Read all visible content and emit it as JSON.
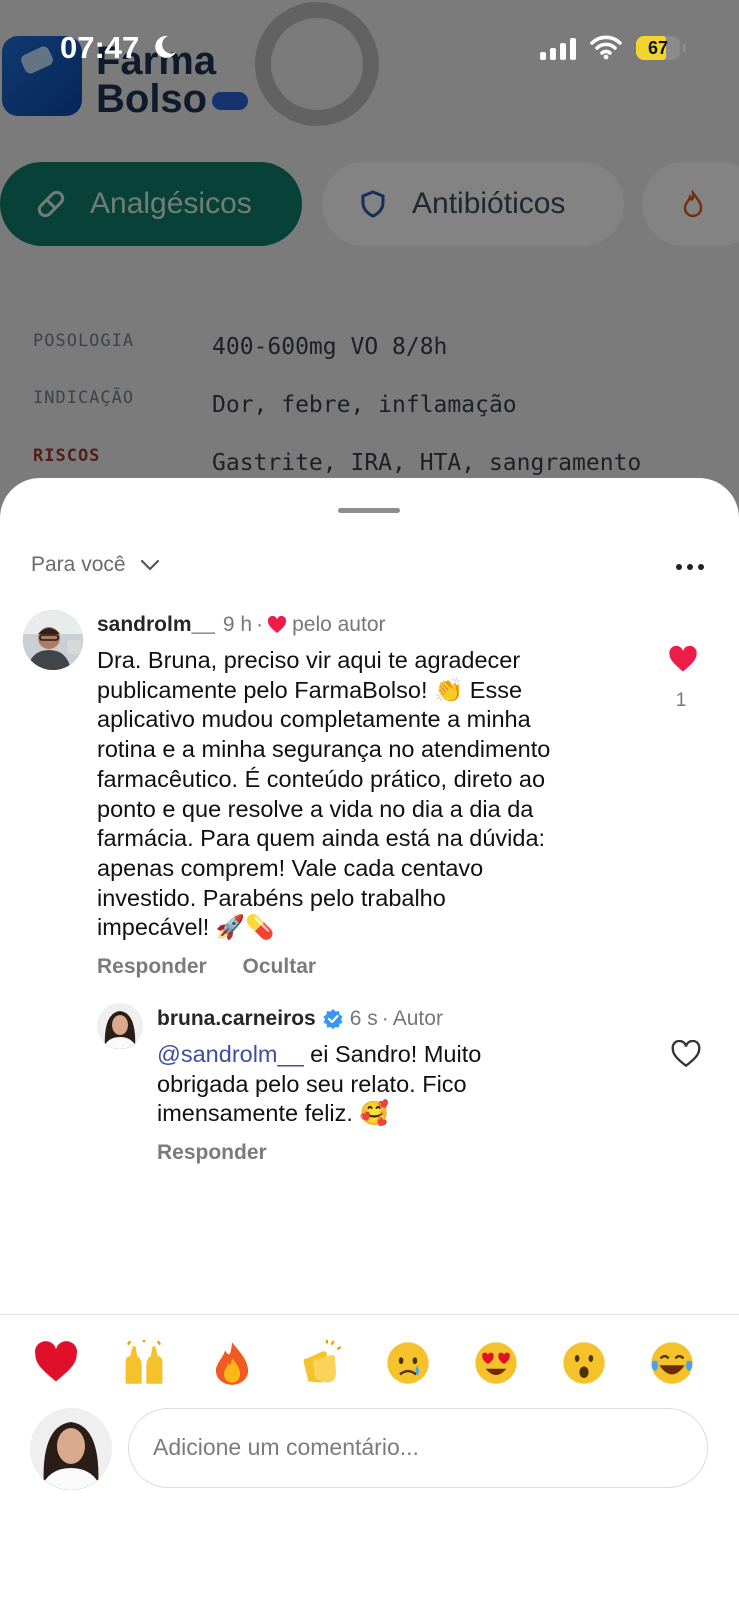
{
  "status_bar": {
    "time": "07:47",
    "battery": "67"
  },
  "background_app": {
    "logo_lines": [
      "Farma",
      "Bolso"
    ],
    "chips": [
      {
        "label": "Analgésicos",
        "active": true
      },
      {
        "label": "Antibióticos",
        "active": false
      }
    ],
    "rows": [
      {
        "label": "POSOLOGIA",
        "value": "400-600mg VO 8/8h"
      },
      {
        "label": "INDICAÇÃO",
        "value": "Dor, febre, inflamação"
      },
      {
        "label": "RISCOS",
        "value": "Gastrite, IRA, HTA, sangramento"
      }
    ]
  },
  "sheet": {
    "sort_label": "Para você",
    "comments": [
      {
        "username": "sandrolm__",
        "time": "9 h",
        "liked_by_author": "pelo autor",
        "text_lines": [
          "Dra. Bruna, preciso vir aqui te agradecer",
          "publicamente pelo FarmaBolso! 👏 Esse",
          "aplicativo mudou completamente a minha",
          "rotina e a minha segurança no atendimento",
          "farmacêutico. É conteúdo prático, direto ao",
          "ponto e que resolve a vida no dia a dia da",
          "farmácia. Para quem ainda está na dúvida:",
          "apenas comprem! Vale cada centavo",
          "investido. Parabéns pelo trabalho",
          "impecável! 🚀💊"
        ],
        "like_count": "1",
        "actions": [
          "Responder",
          "Ocultar"
        ]
      }
    ],
    "reply": {
      "username": "bruna.carneiros",
      "time": "6 s",
      "role": "Autor",
      "mention": "@sandrolm__",
      "text_first": " ei Sandro! Muito",
      "text_lines": [
        "obrigada pelo seu relato. Fico",
        "imensamente feliz. 🥰"
      ],
      "action": "Responder"
    }
  },
  "emoji_reactions": [
    "heart",
    "raised-hands",
    "fire",
    "clapping-hands",
    "crying-face",
    "heart-eyes-face",
    "surprised-face",
    "tears-of-joy-face"
  ],
  "comment_input": {
    "placeholder": "Adicione um comentário..."
  },
  "colors": {
    "like_red": "#ed1d49",
    "mention_blue": "#3e4ea1",
    "verified_blue": "#3897f0"
  }
}
